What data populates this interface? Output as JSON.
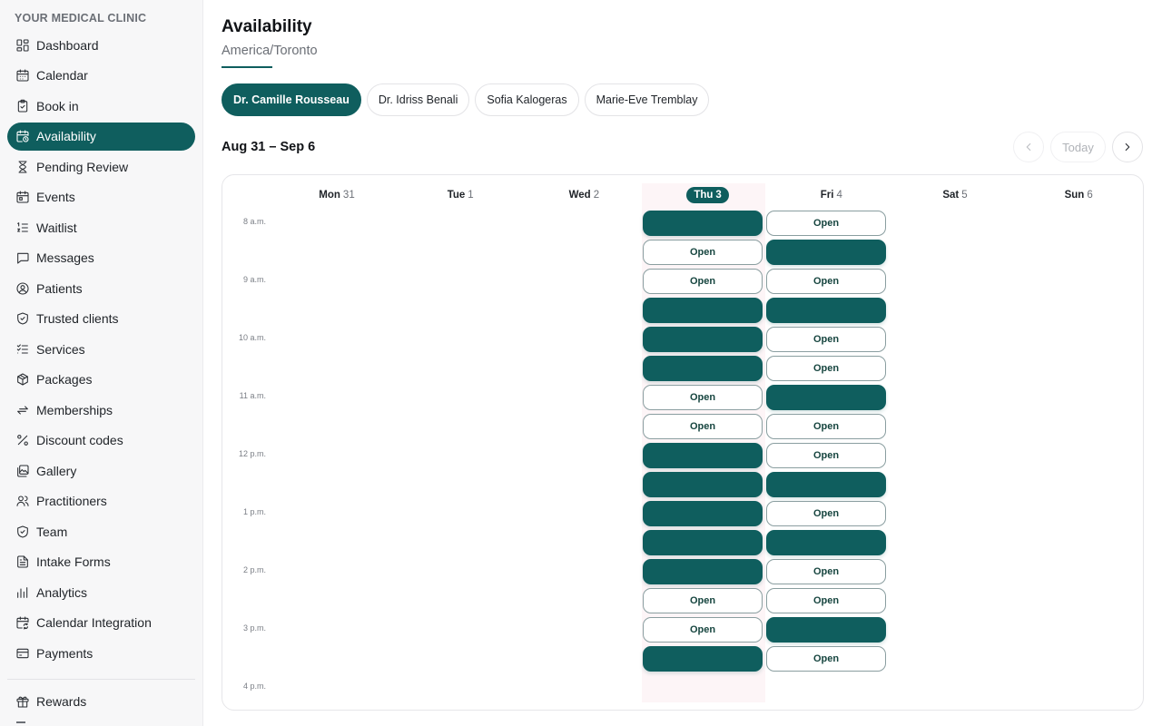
{
  "sidebar": {
    "clinic_name": "YOUR MEDICAL CLINIC",
    "items": [
      {
        "label": "Dashboard",
        "icon": "dashboard-icon"
      },
      {
        "label": "Calendar",
        "icon": "calendar-icon"
      },
      {
        "label": "Book in",
        "icon": "clipboard-icon"
      },
      {
        "label": "Availability",
        "icon": "calendar-clock-icon",
        "active": true
      },
      {
        "label": "Pending Review",
        "icon": "hourglass-icon"
      },
      {
        "label": "Events",
        "icon": "calendar-event-icon"
      },
      {
        "label": "Waitlist",
        "icon": "list-ordered-icon"
      },
      {
        "label": "Messages",
        "icon": "message-icon"
      },
      {
        "label": "Patients",
        "icon": "user-circle-icon"
      },
      {
        "label": "Trusted clients",
        "icon": "shield-check-icon"
      },
      {
        "label": "Services",
        "icon": "list-check-icon"
      },
      {
        "label": "Packages",
        "icon": "package-icon"
      },
      {
        "label": "Memberships",
        "icon": "arrows-exchange-icon"
      },
      {
        "label": "Discount codes",
        "icon": "percent-icon"
      },
      {
        "label": "Gallery",
        "icon": "gallery-icon"
      },
      {
        "label": "Practitioners",
        "icon": "users-icon"
      },
      {
        "label": "Team",
        "icon": "shield-icon"
      },
      {
        "label": "Intake Forms",
        "icon": "file-text-icon"
      },
      {
        "label": "Analytics",
        "icon": "bar-chart-icon"
      },
      {
        "label": "Calendar Integration",
        "icon": "calendar-sync-icon"
      },
      {
        "label": "Payments",
        "icon": "credit-card-icon"
      }
    ],
    "bottom_items": [
      {
        "label": "Rewards",
        "icon": "gift-icon"
      }
    ]
  },
  "header": {
    "title": "Availability",
    "timezone_tab": "America/Toronto"
  },
  "practitioners": [
    {
      "label": "Dr. Camille Rousseau",
      "active": true
    },
    {
      "label": "Dr. Idriss Benali"
    },
    {
      "label": "Sofia Kalogeras"
    },
    {
      "label": "Marie-Eve Tremblay"
    }
  ],
  "week": {
    "range_label": "Aug 31 – Sep 6",
    "today_label": "Today",
    "days": [
      {
        "name": "Mon",
        "num": "31"
      },
      {
        "name": "Tue",
        "num": "1"
      },
      {
        "name": "Wed",
        "num": "2"
      },
      {
        "name": "Thu",
        "num": "3",
        "today": true
      },
      {
        "name": "Fri",
        "num": "4"
      },
      {
        "name": "Sat",
        "num": "5"
      },
      {
        "name": "Sun",
        "num": "6"
      }
    ],
    "hours": [
      "8 a.m.",
      "9 a.m.",
      "10 a.m.",
      "11 a.m.",
      "12 p.m.",
      "1 p.m.",
      "2 p.m.",
      "3 p.m.",
      "4 p.m."
    ],
    "open_label": "Open",
    "slots": {
      "thu": [
        "booked",
        "open",
        "open",
        "booked",
        "booked",
        "booked",
        "open",
        "open",
        "booked",
        "booked",
        "booked",
        "booked",
        "booked",
        "open",
        "open",
        "booked"
      ],
      "fri": [
        "open",
        "booked",
        "open",
        "booked",
        "open",
        "open",
        "booked",
        "open",
        "open",
        "booked",
        "open",
        "booked",
        "open",
        "open",
        "booked",
        "open"
      ]
    }
  }
}
